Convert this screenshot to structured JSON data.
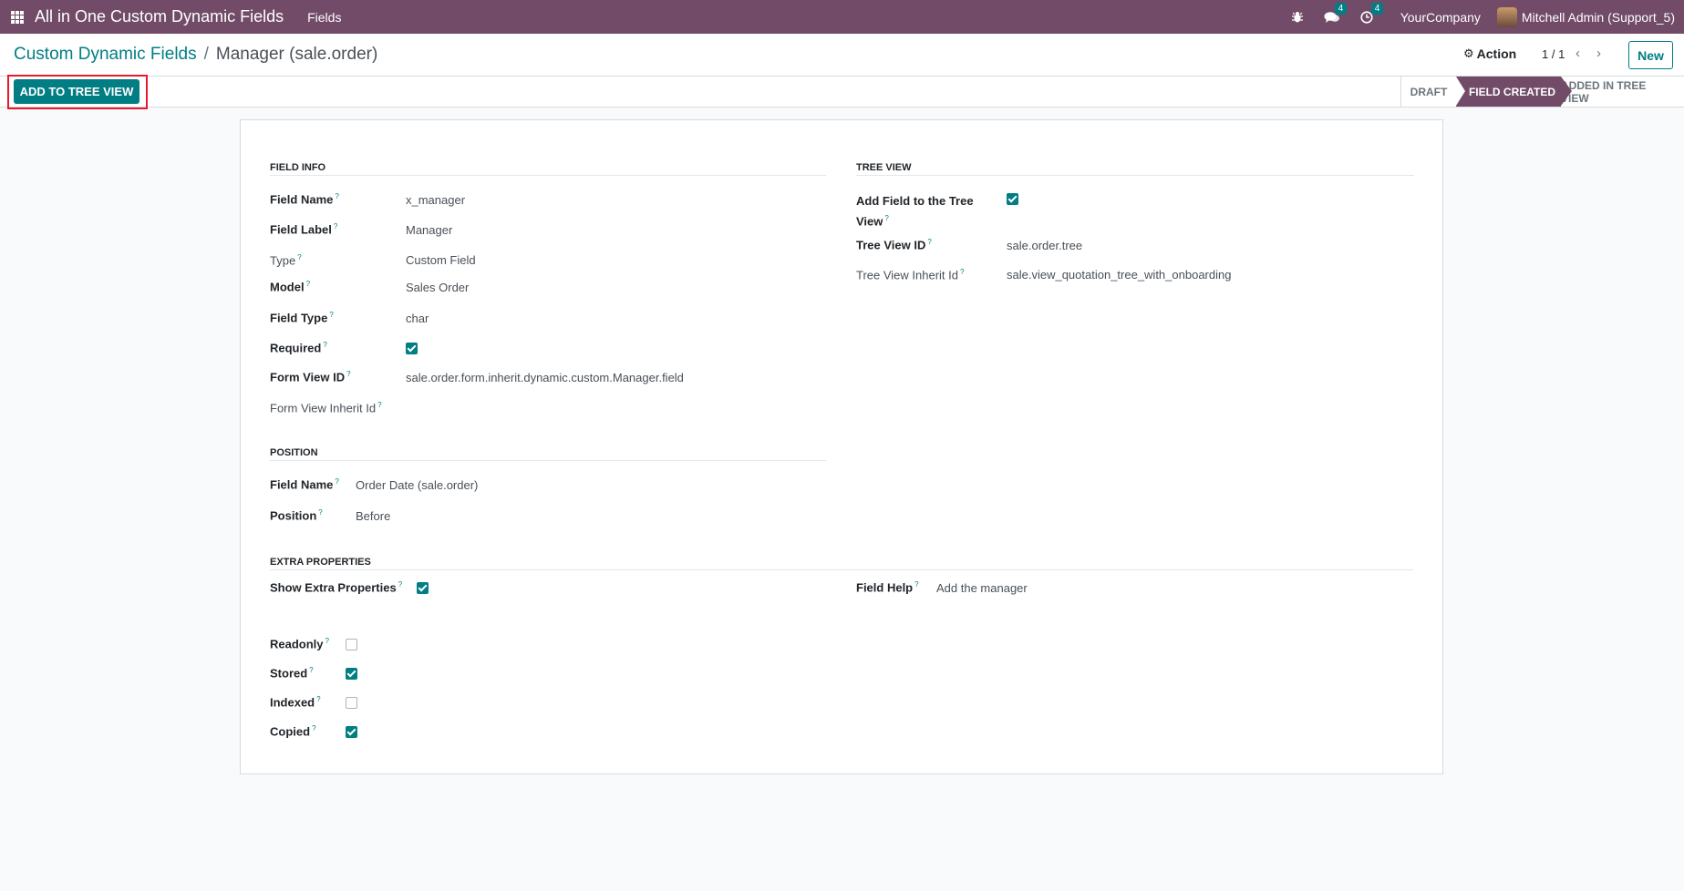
{
  "navbar": {
    "app_title": "All in One Custom Dynamic Fields",
    "menu_fields": "Fields",
    "messages_count": "4",
    "activities_count": "4",
    "company": "YourCompany",
    "user": "Mitchell Admin (Support_5)"
  },
  "control": {
    "breadcrumb_parent": "Custom Dynamic Fields",
    "breadcrumb_separator": "/",
    "breadcrumb_current": "Manager (sale.order)",
    "action_label": "Action",
    "pager": "1 / 1",
    "new_label": "New"
  },
  "statusbar": {
    "add_tree_view": "ADD TO TREE VIEW",
    "stages": [
      "DRAFT",
      "FIELD CREATED",
      "ADDED IN TREE VIEW"
    ],
    "active_stage": "FIELD CREATED"
  },
  "field_info": {
    "title": "FIELD INFO",
    "field_name_label": "Field Name",
    "field_name": "x_manager",
    "field_label_label": "Field Label",
    "field_label": "Manager",
    "type_label": "Type",
    "type": "Custom Field",
    "model_label": "Model",
    "model": "Sales Order",
    "field_type_label": "Field Type",
    "field_type": "char",
    "required_label": "Required",
    "required": true,
    "form_view_id_label": "Form View ID",
    "form_view_id": "sale.order.form.inherit.dynamic.custom.Manager.field",
    "form_view_inherit_label": "Form View Inherit Id",
    "form_view_inherit": ""
  },
  "tree_view": {
    "title": "TREE VIEW",
    "add_field_label_line1": "Add Field to the Tree",
    "add_field_label_line2": "View",
    "add_field": true,
    "tree_view_id_label": "Tree View ID",
    "tree_view_id": "sale.order.tree",
    "tree_view_inherit_label": "Tree View Inherit Id",
    "tree_view_inherit": "sale.view_quotation_tree_with_onboarding"
  },
  "position": {
    "title": "POSITION",
    "field_name_label": "Field Name",
    "field_name": "Order Date (sale.order)",
    "position_label": "Position",
    "position": "Before"
  },
  "extra": {
    "title": "EXTRA PROPERTIES",
    "show_extra_label": "Show Extra Properties",
    "show_extra": true,
    "field_help_label": "Field Help",
    "field_help": "Add the manager",
    "readonly_label": "Readonly",
    "readonly": false,
    "stored_label": "Stored",
    "stored": true,
    "indexed_label": "Indexed",
    "indexed": false,
    "copied_label": "Copied",
    "copied": true
  },
  "tooltip_mark": "?",
  "colors": {
    "brand": "#714b67",
    "accent": "#017e84",
    "highlight": "#e8192c"
  }
}
